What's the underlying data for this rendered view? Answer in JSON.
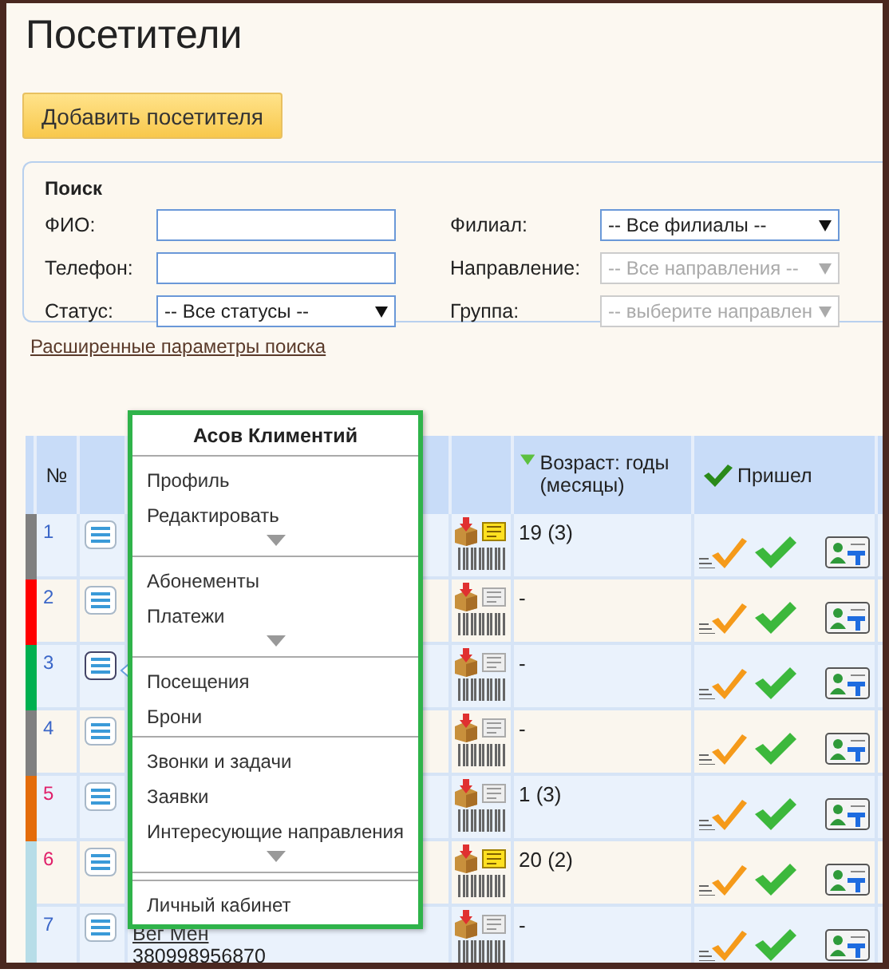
{
  "page": {
    "title": "Посетители"
  },
  "add_button": "Добавить посетителя",
  "search": {
    "title": "Поиск",
    "fields": [
      {
        "label": "ФИО:",
        "kind": "text"
      },
      {
        "label": "Филиал:",
        "kind": "select",
        "value": "-- Все филиалы --",
        "disabled": false
      },
      {
        "label": "Телефон:",
        "kind": "text"
      },
      {
        "label": "Направление:",
        "kind": "select",
        "value": "-- Все направления --",
        "disabled": true
      },
      {
        "label": "Статус:",
        "kind": "select",
        "value": "-- Все статусы --",
        "disabled": false
      },
      {
        "label": "Группа:",
        "kind": "select",
        "value": "-- выберите направлен",
        "disabled": true
      }
    ],
    "advanced_link": "Расширенные параметры поиска"
  },
  "table": {
    "columns": [
      {
        "label": "№"
      },
      {
        "label": "Возраст: годы (месяцы)",
        "sorted": true
      },
      {
        "label": "Пришел",
        "sorted": false
      }
    ],
    "rows": [
      {
        "number": "1",
        "color": "#808080",
        "highlight": false,
        "selected": false,
        "note": true,
        "age": "19 (3)"
      },
      {
        "number": "2",
        "color": "#ff0000",
        "highlight": false,
        "selected": false,
        "note": false,
        "age": "-"
      },
      {
        "number": "3",
        "color": "#00b050",
        "highlight": false,
        "selected": true,
        "note": false,
        "age": "-"
      },
      {
        "number": "4",
        "color": "#808080",
        "highlight": false,
        "selected": false,
        "note": false,
        "age": "-"
      },
      {
        "number": "5",
        "color": "#e46c0a",
        "highlight": true,
        "selected": false,
        "note": false,
        "age": "1 (3)"
      },
      {
        "number": "6",
        "color": "#b7dde8",
        "highlight": true,
        "selected": false,
        "note": true,
        "age": "20 (2)"
      },
      {
        "number": "7",
        "color": "#b7dde8",
        "highlight": false,
        "selected": false,
        "note": false,
        "age": "-",
        "name": "Вег Мен",
        "phone": "380998956870"
      }
    ]
  },
  "popup": {
    "title": "Асов Климентий",
    "sections": [
      {
        "items": [
          "Профиль",
          "Редактировать"
        ],
        "more": true
      },
      {
        "items": [
          "Абонементы",
          "Платежи"
        ],
        "more": true
      },
      {
        "items": [
          "Посещения",
          "Брони"
        ],
        "more": false
      },
      {
        "items": [
          "Звонки и задачи",
          "Заявки",
          "Интересующие направления"
        ],
        "more": true
      },
      {
        "items": [
          "Личный кабинет"
        ],
        "more": false
      }
    ]
  }
}
